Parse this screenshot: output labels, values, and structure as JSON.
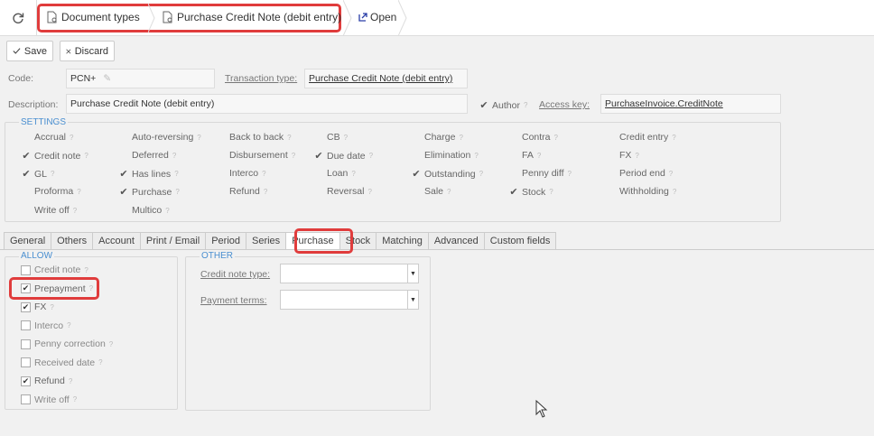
{
  "breadcrumb": {
    "items": [
      "Document types",
      "Purchase Credit Note (debit entry)"
    ],
    "open_label": "Open"
  },
  "toolbar": {
    "save_label": "Save",
    "discard_label": "Discard"
  },
  "form": {
    "code_label": "Code:",
    "code_value": "PCN+",
    "transaction_type_label": "Transaction type:",
    "transaction_type_value": "Purchase Credit Note (debit entry)",
    "description_label": "Description:",
    "description_value": "Purchase Credit Note (debit entry)",
    "author_label": "Author",
    "access_key_label": "Access key:",
    "access_key_value": "PurchaseInvoice.CreditNote"
  },
  "settings": {
    "legend": "SETTINGS",
    "items": [
      {
        "label": "Accrual",
        "checked": false
      },
      {
        "label": "Auto-reversing",
        "checked": false
      },
      {
        "label": "Back to back",
        "checked": false
      },
      {
        "label": "CB",
        "checked": false
      },
      {
        "label": "Charge",
        "checked": false
      },
      {
        "label": "Contra",
        "checked": false
      },
      {
        "label": "Credit entry",
        "checked": false
      },
      {
        "label": "Credit note",
        "checked": true
      },
      {
        "label": "Deferred",
        "checked": false
      },
      {
        "label": "Disbursement",
        "checked": false
      },
      {
        "label": "Due date",
        "checked": true
      },
      {
        "label": "Elimination",
        "checked": false
      },
      {
        "label": "FA",
        "checked": false
      },
      {
        "label": "FX",
        "checked": false
      },
      {
        "label": "GL",
        "checked": true
      },
      {
        "label": "Has lines",
        "checked": true
      },
      {
        "label": "Interco",
        "checked": false
      },
      {
        "label": "Loan",
        "checked": false
      },
      {
        "label": "Outstanding",
        "checked": true
      },
      {
        "label": "Penny diff",
        "checked": false
      },
      {
        "label": "Period end",
        "checked": false
      },
      {
        "label": "Proforma",
        "checked": false
      },
      {
        "label": "Purchase",
        "checked": true
      },
      {
        "label": "Refund",
        "checked": false
      },
      {
        "label": "Reversal",
        "checked": false
      },
      {
        "label": "Sale",
        "checked": false
      },
      {
        "label": "Stock",
        "checked": true
      },
      {
        "label": "Withholding",
        "checked": false
      },
      {
        "label": "Write off",
        "checked": false
      },
      {
        "label": "Multico",
        "checked": false
      }
    ]
  },
  "tabs": [
    "General",
    "Others",
    "Account",
    "Print / Email",
    "Period",
    "Series",
    "Purchase",
    "Stock",
    "Matching",
    "Advanced",
    "Custom fields"
  ],
  "active_tab": "Purchase",
  "allow": {
    "legend": "ALLOW",
    "items": [
      {
        "label": "Credit note",
        "checked": false
      },
      {
        "label": "Prepayment",
        "checked": true
      },
      {
        "label": "FX",
        "checked": true
      },
      {
        "label": "Interco",
        "checked": false
      },
      {
        "label": "Penny correction",
        "checked": false
      },
      {
        "label": "Received date",
        "checked": false
      },
      {
        "label": "Refund",
        "checked": true
      },
      {
        "label": "Write off",
        "checked": false
      }
    ]
  },
  "other": {
    "legend": "OTHER",
    "credit_note_type_label": "Credit note type:",
    "credit_note_type_value": "",
    "payment_terms_label": "Payment terms:",
    "payment_terms_value": ""
  },
  "icons": {
    "refresh": "refresh-icon",
    "doc": "document-settings-icon",
    "open": "open-link-icon",
    "save": "check-icon",
    "discard": "close-icon",
    "edit": "pencil-icon",
    "help": "help-mark-icon"
  },
  "colors": {
    "highlight": "#e03c3c",
    "legend": "#4a8fd0",
    "open_icon": "#2a3ea8"
  }
}
